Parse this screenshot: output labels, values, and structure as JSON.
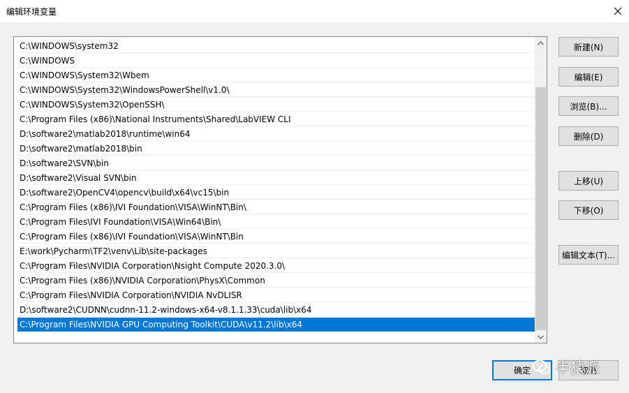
{
  "window": {
    "title": "编辑环境变量",
    "close_icon": "close-icon"
  },
  "paths": [
    "C:\\WINDOWS\\system32",
    "C:\\WINDOWS",
    "C:\\WINDOWS\\System32\\Wbem",
    "C:\\WINDOWS\\System32\\WindowsPowerShell\\v1.0\\",
    "C:\\WINDOWS\\System32\\OpenSSH\\",
    "C:\\Program Files (x86)\\National Instruments\\Shared\\LabVIEW CLI",
    "D:\\software2\\matlab2018\\runtime\\win64",
    "D:\\software2\\matlab2018\\bin",
    "D:\\software2\\SVN\\bin",
    "D:\\software2\\Visual SVN\\bin",
    "D:\\software2\\OpenCV4\\opencv\\build\\x64\\vc15\\bin",
    "C:\\Program Files (x86)\\IVI Foundation\\VISA\\WinNT\\Bin\\",
    "C:\\Program Files\\IVI Foundation\\VISA\\Win64\\Bin\\",
    "C:\\Program Files (x86)\\IVI Foundation\\VISA\\WinNT\\Bin",
    "E:\\work\\Pycharm\\TF2\\venv\\Lib\\site-packages",
    "C:\\Program Files\\NVIDIA Corporation\\Nsight Compute 2020.3.0\\",
    "C:\\Program Files (x86)\\NVIDIA Corporation\\PhysX\\Common",
    "C:\\Program Files\\NVIDIA Corporation\\NVIDIA NvDLISR",
    "D:\\software2\\CUDNN\\cudnn-11.2-windows-x64-v8.1.1.33\\cuda\\lib\\x64",
    "C:\\Program Files\\NVIDIA GPU Computing Toolkit\\CUDA\\v11.2\\lib\\x64"
  ],
  "selected_index": 19,
  "buttons": {
    "new": "新建(N)",
    "edit": "编辑(E)",
    "browse": "浏览(B)...",
    "delete": "删除(D)",
    "move_up": "上移(U)",
    "move_down": "下移(O)",
    "edit_text": "编辑文本(T)...",
    "ok": "确定",
    "cancel": "取消"
  },
  "watermark": {
    "text": "半猿派",
    "icon": "wechat-icon"
  },
  "colors": {
    "selection": "#0078d7",
    "background": "#f0f0f0"
  }
}
